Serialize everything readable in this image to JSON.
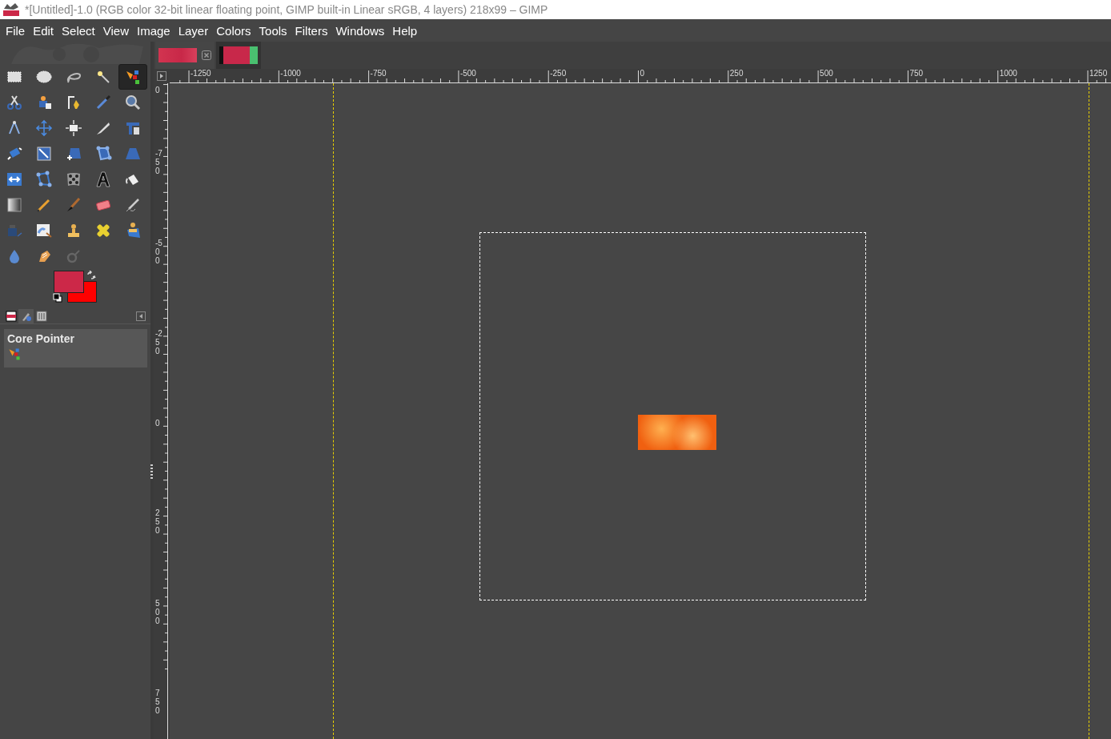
{
  "window": {
    "title": "*[Untitled]-1.0 (RGB color 32-bit linear floating point, GIMP built-in Linear sRGB, 4 layers) 218x99 – GIMP"
  },
  "menu": [
    "File",
    "Edit",
    "Select",
    "View",
    "Image",
    "Layer",
    "Colors",
    "Tools",
    "Filters",
    "Windows",
    "Help"
  ],
  "toolbox": {
    "tools": [
      {
        "kind": "rect",
        "selected": false
      },
      {
        "kind": "ellipse",
        "selected": false
      },
      {
        "kind": "lasso",
        "selected": false
      },
      {
        "kind": "wand",
        "selected": false
      },
      {
        "kind": "device",
        "selected": true
      },
      {
        "kind": "scissors",
        "selected": false
      },
      {
        "kind": "fgselect",
        "selected": false
      },
      {
        "kind": "paths",
        "selected": false
      },
      {
        "kind": "picker",
        "selected": false
      },
      {
        "kind": "zoom",
        "selected": false
      },
      {
        "kind": "measure",
        "selected": false
      },
      {
        "kind": "move",
        "selected": false
      },
      {
        "kind": "align",
        "selected": false
      },
      {
        "kind": "knife",
        "selected": false
      },
      {
        "kind": "crop",
        "selected": false
      },
      {
        "kind": "rotate",
        "selected": false
      },
      {
        "kind": "scale",
        "selected": false
      },
      {
        "kind": "shear",
        "selected": false
      },
      {
        "kind": "nodes",
        "selected": false
      },
      {
        "kind": "perspective",
        "selected": false
      },
      {
        "kind": "flip",
        "selected": false
      },
      {
        "kind": "cage",
        "selected": false
      },
      {
        "kind": "checker",
        "selected": false
      },
      {
        "kind": "text",
        "selected": false
      },
      {
        "kind": "bucket",
        "selected": false
      },
      {
        "kind": "gradient",
        "selected": false
      },
      {
        "kind": "pencil",
        "selected": false
      },
      {
        "kind": "brush",
        "selected": false
      },
      {
        "kind": "eraser",
        "selected": false
      },
      {
        "kind": "airbrush",
        "selected": false
      },
      {
        "kind": "ink",
        "selected": false
      },
      {
        "kind": "mypaint",
        "selected": false
      },
      {
        "kind": "stamp",
        "selected": false
      },
      {
        "kind": "heal",
        "selected": false
      },
      {
        "kind": "pclone",
        "selected": false
      },
      {
        "kind": "drop",
        "selected": false
      },
      {
        "kind": "smudge",
        "selected": false
      },
      {
        "kind": "dodge",
        "selected": false
      }
    ]
  },
  "dock": {
    "tabs": [
      {
        "kind": "pattern",
        "selected": false
      },
      {
        "kind": "device",
        "selected": true
      },
      {
        "kind": "sliders",
        "selected": false
      }
    ],
    "panel": {
      "title": "Core Pointer"
    }
  },
  "image_tabs": [
    {
      "selected": true
    },
    {
      "selected": false
    }
  ],
  "horizontal_ruler": {
    "labels": [
      "-1250",
      "-1000",
      "-750",
      "-500",
      "-250",
      "0",
      "250",
      "500",
      "750",
      "1000",
      "1250"
    ]
  },
  "vertical_ruler": {
    "cut_label": "0",
    "labels": [
      "-750",
      "-500",
      "-250",
      "0",
      "250",
      "500",
      "750"
    ]
  }
}
